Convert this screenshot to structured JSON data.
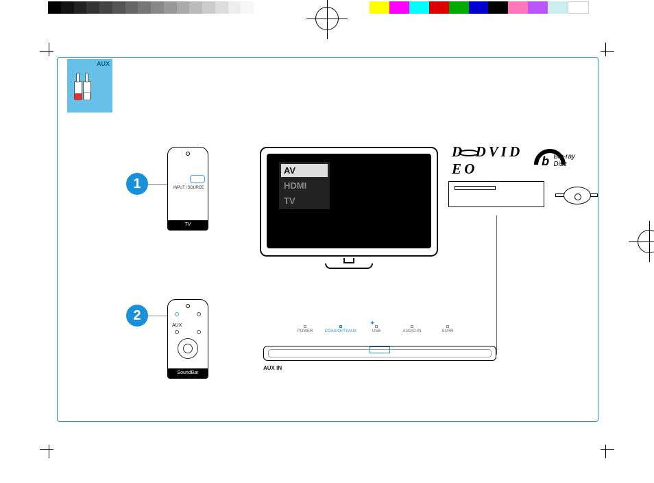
{
  "badge": {
    "label": "AUX"
  },
  "steps": {
    "one": "1",
    "two": "2"
  },
  "remote_tv": {
    "button_label": "INPUT / SOURCE",
    "device_label": "TV"
  },
  "remote_soundbar": {
    "pointer_label": "AUX",
    "device_label": "SoundBar"
  },
  "tv_menu": {
    "options": [
      "AV",
      "HDMI",
      "TV"
    ],
    "selected_index": 0
  },
  "logos": {
    "dvd": "DVD",
    "dvd_sub": "V I D E O",
    "bluray_b": "b",
    "bluray_text": "Blu-ray Disc"
  },
  "soundbar": {
    "indicators": [
      "POWER",
      "COAX/OPTI/AUX",
      "USB",
      "AUDIO-IN",
      "SURR"
    ],
    "highlighted_index": 1,
    "port_label": "AUX IN"
  }
}
